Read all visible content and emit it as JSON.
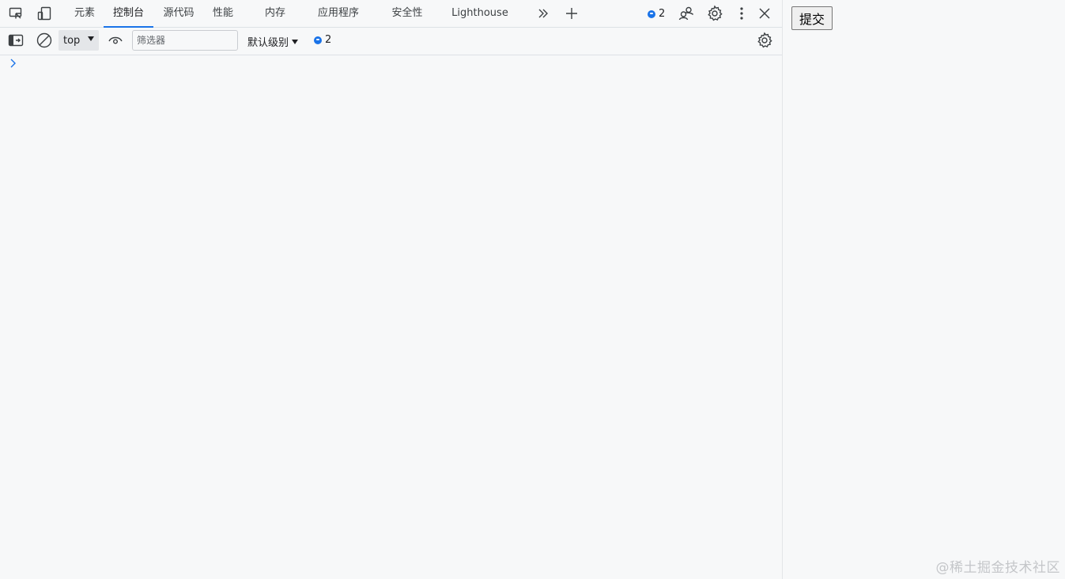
{
  "tabs": [
    {
      "label": "元素",
      "active": false
    },
    {
      "label": "控制台",
      "active": true
    },
    {
      "label": "源代码",
      "active": false
    },
    {
      "label": "性能",
      "active": false
    },
    {
      "label": "内存",
      "active": false
    },
    {
      "label": "应用程序",
      "active": false
    },
    {
      "label": "安全性",
      "active": false
    },
    {
      "label": "Lighthouse",
      "active": false
    }
  ],
  "tabbar": {
    "issues_count": "2"
  },
  "console_toolbar": {
    "context": "top",
    "filter_placeholder": "筛选器",
    "filter_value": "",
    "levels": "默认级别",
    "issues_count": "2"
  },
  "page": {
    "submit_label": "提交"
  },
  "watermark": "@稀土掘金技术社区",
  "colors": {
    "accent": "#1a73e8",
    "background": "#f7f8f9"
  }
}
